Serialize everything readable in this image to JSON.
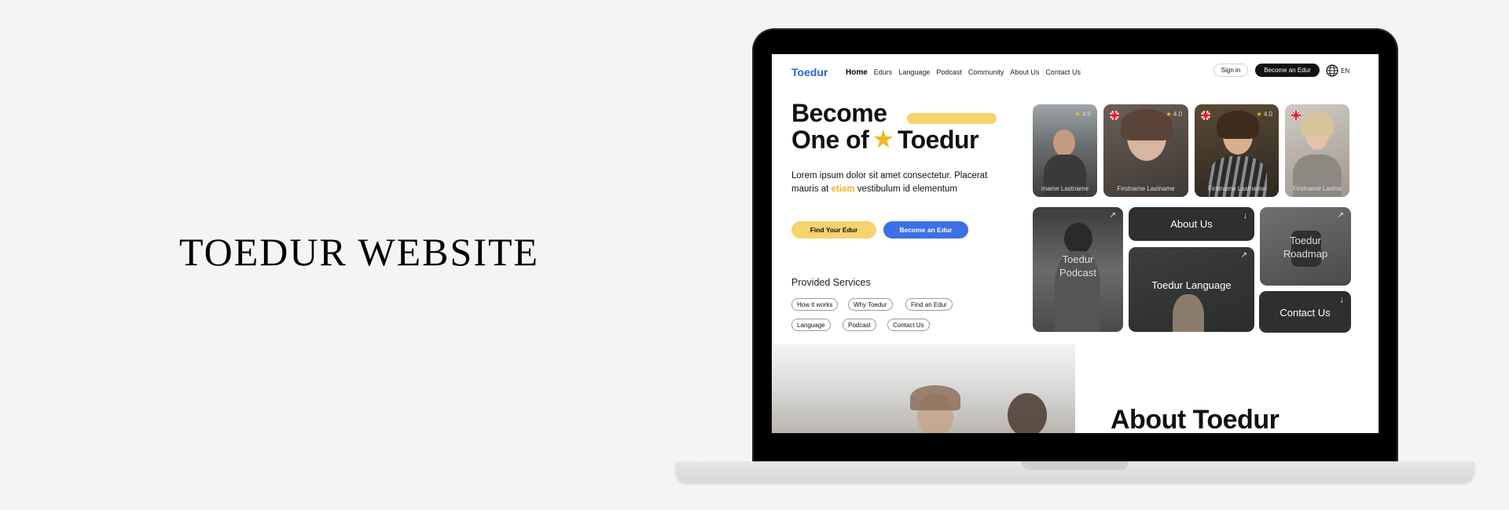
{
  "page_title": "TOEDUR WEBSITE",
  "nav": {
    "logo": "Toedur",
    "links": [
      "Home",
      "Edurs",
      "Language",
      "Podcast",
      "Community",
      "About Us",
      "Contact Us"
    ],
    "sign_in": "Sign in",
    "become": "Become an Edur",
    "language": "EN"
  },
  "hero": {
    "line1": "Become",
    "line2_a": "One of",
    "line2_b": "Toedur",
    "lead_a": "Lorem ipsum dolor sit amet consectetur. Placerat mauris at ",
    "lead_accent": "etiam",
    "lead_b": " vestibulum id elementum",
    "btn_find": "Find Your Edur",
    "btn_become": "Become an Edur"
  },
  "services": {
    "title": "Provided Services",
    "chips": [
      "How it works",
      "Why Toedur",
      "Find an Edur",
      "Language",
      "Podcast",
      "Contact Us"
    ]
  },
  "tutors": [
    {
      "name": "rname Lastname",
      "rating": "4.0",
      "flag": false
    },
    {
      "name": "Firstname Lastname",
      "rating": "4.0",
      "flag": true
    },
    {
      "name": "Firstname Lastname",
      "rating": "4.0",
      "flag": true
    },
    {
      "name": "Firstname Lastna",
      "rating": "",
      "flag": true
    }
  ],
  "tiles": {
    "podcast": "Toedur Podcast",
    "about": "About Us",
    "language": "Toedur Language",
    "roadmap": "Toedur Roadmap",
    "contact": "Contact Us"
  },
  "about": {
    "title": "About Toedur"
  },
  "colors": {
    "brand_blue": "#2b63d9",
    "accent_yellow": "#f5d36e",
    "button_blue": "#3d6fe8",
    "dark": "#111111"
  }
}
